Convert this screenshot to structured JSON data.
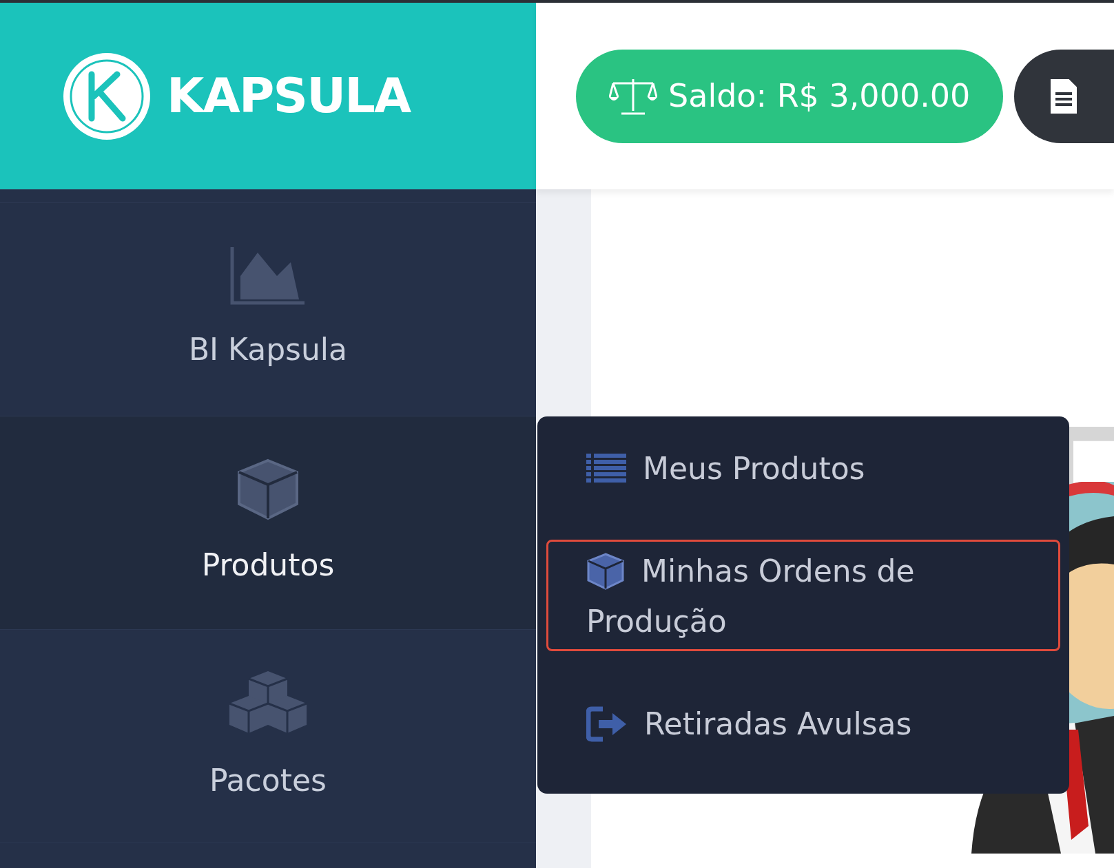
{
  "header": {
    "logo_text": "KAPSULA"
  },
  "balance_button": {
    "label": "Saldo: R$ 3,000.00"
  },
  "sidebar": {
    "items": [
      {
        "label": "BI Kapsula",
        "kind": "chart",
        "selected": false
      },
      {
        "label": "Produtos",
        "kind": "cube",
        "selected": true
      },
      {
        "label": "Pacotes",
        "kind": "cubes",
        "selected": false
      }
    ]
  },
  "submenu": {
    "items": [
      {
        "label": "Meus Produtos",
        "kind": "list",
        "highlighted": false
      },
      {
        "label": "Minhas Ordens de Produção",
        "kind": "cube",
        "highlighted": true
      },
      {
        "label": "Retiradas Avulsas",
        "kind": "exit",
        "highlighted": false
      }
    ]
  }
}
